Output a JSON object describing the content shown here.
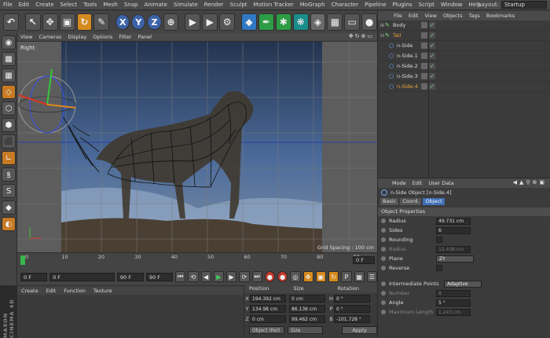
{
  "menubar": {
    "items": [
      "File",
      "Edit",
      "Create",
      "Select",
      "Tools",
      "Mesh",
      "Snap",
      "Animate",
      "Simulate",
      "Render",
      "Sculpt",
      "Motion Tracker",
      "MoGraph",
      "Character",
      "Pipeline",
      "Plugins",
      "Script",
      "Window",
      "Help"
    ],
    "layout_label": "Layout:",
    "layout_value": "Startup"
  },
  "toolbar": {
    "axis_x": "X",
    "axis_y": "Y",
    "axis_z": "Z"
  },
  "viewport": {
    "menu": [
      "View",
      "Cameras",
      "Display",
      "Options",
      "Filter",
      "Panel"
    ],
    "label": "Right",
    "grid_spacing": "Grid Spacing : 100 cm"
  },
  "timeline": {
    "ticks": [
      "0",
      "10",
      "20",
      "30",
      "40",
      "50",
      "60",
      "70",
      "80",
      "90"
    ],
    "frame": "0 F"
  },
  "transport": {
    "start_frame": "0 F",
    "current_frame": "0 F",
    "end_min": "90 F",
    "end_max": "90 F"
  },
  "material": {
    "menu": [
      "Create",
      "Edit",
      "Function",
      "Texture"
    ]
  },
  "brand": "MAXON CINEMA 4D",
  "coordinates": {
    "headers": [
      "Position",
      "Size",
      "Rotation"
    ],
    "rows": [
      {
        "axis": "X",
        "pos": "194.392 cm",
        "size": "0 cm",
        "rot_axis": "H",
        "rot": "0 °"
      },
      {
        "axis": "Y",
        "pos": "134.98 cm",
        "size": "86.136 cm",
        "rot_axis": "P",
        "rot": "0 °"
      },
      {
        "axis": "Z",
        "pos": "0 cm",
        "size": "99.462 cm",
        "rot_axis": "B",
        "rot": "-101.728 °"
      }
    ],
    "mode": "Object (Rel)",
    "size_mode": "Size",
    "apply": "Apply"
  },
  "object_manager": {
    "menu": [
      "File",
      "Edit",
      "View",
      "Objects",
      "Tags",
      "Bookmarks"
    ],
    "objects": [
      {
        "name": "Body",
        "indent": 0,
        "selected": false
      },
      {
        "name": "Tail",
        "indent": 0,
        "selected": false
      },
      {
        "name": "n-Side",
        "indent": 1,
        "selected": false
      },
      {
        "name": "n-Side.1",
        "indent": 1,
        "selected": false
      },
      {
        "name": "n-Side.2",
        "indent": 1,
        "selected": false
      },
      {
        "name": "n-Side.3",
        "indent": 1,
        "selected": false
      },
      {
        "name": "n-Side.4",
        "indent": 1,
        "selected": true
      }
    ]
  },
  "attributes": {
    "menu": [
      "Mode",
      "Edit",
      "User Data"
    ],
    "title": "n-Side Object [n-Side.4]",
    "tabs": [
      "Basic",
      "Coord.",
      "Object"
    ],
    "active_tab": "Object",
    "section_title": "Object Properties",
    "radius_label": "Radius",
    "radius_value": "49.731 cm",
    "sides_label": "Sides",
    "sides_value": "6",
    "rounding_label": "Rounding",
    "radius2_label": "Radius",
    "radius2_value": "12.438 cm",
    "plane_label": "Plane",
    "plane_value": "ZY",
    "reverse_label": "Reverse",
    "interp_label": "Intermediate Points",
    "interp_value": "Adaptive",
    "number_label": "Number",
    "number_value": "8",
    "angle_label": "Angle",
    "angle_value": "5 °",
    "maxlen_label": "Maximum Length",
    "maxlen_value": "1.243 cm"
  },
  "colors": {
    "accent_blue": "#3f6fb7",
    "selection_orange": "#f0a23a",
    "viewport_bg": "#5a5a5a"
  }
}
